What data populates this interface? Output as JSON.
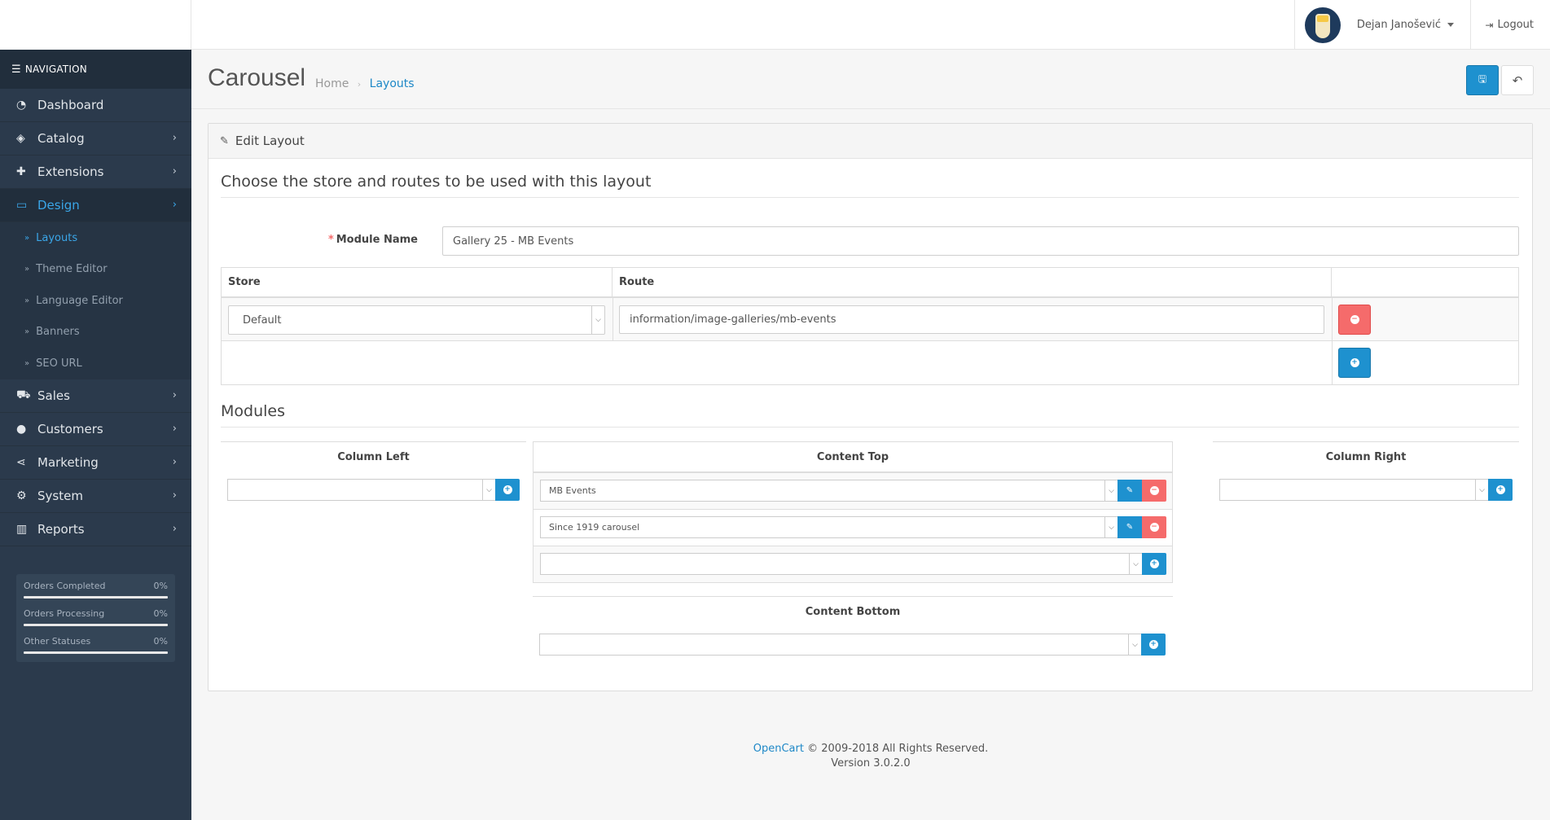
{
  "header": {
    "user_name": "Dejan Janošević",
    "logout_label": "Logout"
  },
  "sidebar": {
    "nav_title": "NAVIGATION",
    "items": [
      {
        "label": "Dashboard",
        "icon": "dashboard-icon"
      },
      {
        "label": "Catalog",
        "icon": "tags-icon"
      },
      {
        "label": "Extensions",
        "icon": "puzzle-icon"
      },
      {
        "label": "Design",
        "icon": "monitor-icon"
      },
      {
        "label": "Sales",
        "icon": "cart-icon"
      },
      {
        "label": "Customers",
        "icon": "user-icon"
      },
      {
        "label": "Marketing",
        "icon": "share-icon"
      },
      {
        "label": "System",
        "icon": "gear-icon"
      },
      {
        "label": "Reports",
        "icon": "bar-chart-icon"
      }
    ],
    "design_sub": [
      "Layouts",
      "Theme Editor",
      "Language Editor",
      "Banners",
      "SEO URL"
    ],
    "stats": [
      {
        "label": "Orders Completed",
        "value": "0%"
      },
      {
        "label": "Orders Processing",
        "value": "0%"
      },
      {
        "label": "Other Statuses",
        "value": "0%"
      }
    ]
  },
  "page": {
    "title": "Carousel",
    "breadcrumb": [
      "Home",
      "Layouts"
    ]
  },
  "panel": {
    "title": "Edit Layout",
    "legend": "Choose the store and routes to be used with this layout",
    "module_name_label": "Module Name",
    "module_name_value": "Gallery 25 - MB Events",
    "table": {
      "headers": [
        "Store",
        "Route"
      ],
      "store_value": "Default",
      "route_value": "information/image-galleries/mb-events"
    },
    "modules_legend": "Modules",
    "column_left": "Column Left",
    "content_top": "Content Top",
    "column_right": "Column Right",
    "content_bottom": "Content Bottom",
    "content_top_items": [
      "MB Events",
      "Since 1919 carousel"
    ]
  },
  "footer": {
    "brand": "OpenCart",
    "copyright": "© 2009-2018 All Rights Reserved.",
    "version": "Version 3.0.2.0"
  },
  "colors": {
    "primary": "#1e91cf",
    "danger": "#f56b6b",
    "sidebar_bg": "#2b3a4c",
    "active_link": "#3aa6e8"
  }
}
